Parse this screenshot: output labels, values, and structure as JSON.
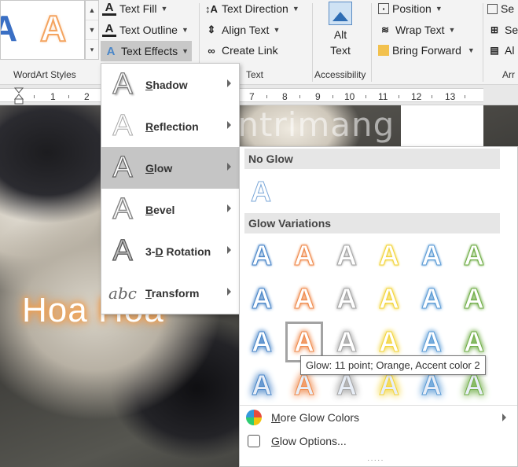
{
  "ribbon": {
    "wordart_gallery": {
      "letters": [
        "A",
        "A"
      ],
      "colors": [
        "#3a6fc4",
        "#f4a460"
      ]
    },
    "wordart_styles_label": "WordArt Styles",
    "text_fill": "Text Fill",
    "text_outline": "Text Outline",
    "text_effects": "Text Effects",
    "text_direction": "Text Direction",
    "align_text": "Align Text",
    "create_link": "Create Link",
    "text_group_label": "Text",
    "alt_text_line1": "Alt",
    "alt_text_line2": "Text",
    "accessibility_label": "Accessibility",
    "position": "Position",
    "wrap_text": "Wrap Text",
    "bring_forward": "Bring Forward",
    "sel_cut": "Se",
    "al_cut": "Al",
    "arr_cut": "Arr"
  },
  "ruler": {
    "numbers": [
      "1",
      "2",
      "7",
      "8",
      "9",
      "10",
      "11",
      "12",
      "13"
    ]
  },
  "document": {
    "wordart_text": "Hoa Hoa",
    "watermark": "uantrimang"
  },
  "text_effects_menu": {
    "items": [
      {
        "icon": "shadow-a-icon",
        "accel": "S",
        "label_rest": "hadow"
      },
      {
        "icon": "reflection-a-icon",
        "accel": "R",
        "label_rest": "eflection"
      },
      {
        "icon": "glow-a-icon",
        "accel": "G",
        "label_rest": "low"
      },
      {
        "icon": "bevel-a-icon",
        "accel": "B",
        "label_rest": "evel"
      },
      {
        "icon": "rotation-a-icon",
        "prefix": "3-",
        "accel": "D",
        "label_rest": " Rotation"
      },
      {
        "icon": "transform-abc-icon",
        "accel": "T",
        "label_rest": "ransform",
        "glyph": "abc"
      }
    ],
    "icon_glyph": "A",
    "active_item": "Glow"
  },
  "glow_submenu": {
    "no_glow_header": "No Glow",
    "variations_header": "Glow Variations",
    "glyph": "A",
    "accent_colors": [
      "#4a86c8",
      "#ef8a4c",
      "#a5a5a5",
      "#f2d43b",
      "#5b9bd5",
      "#70ad47"
    ],
    "glow_sizes": [
      "5 point",
      "8 point",
      "11 point",
      "18 point"
    ],
    "selected": {
      "row": 2,
      "col": 1
    },
    "more_glow_colors_accel": "M",
    "more_glow_colors_rest": "ore Glow Colors",
    "glow_options_accel": "G",
    "glow_options_rest": "low Options..."
  },
  "tooltip": "Glow: 11 point; Orange, Accent color 2"
}
